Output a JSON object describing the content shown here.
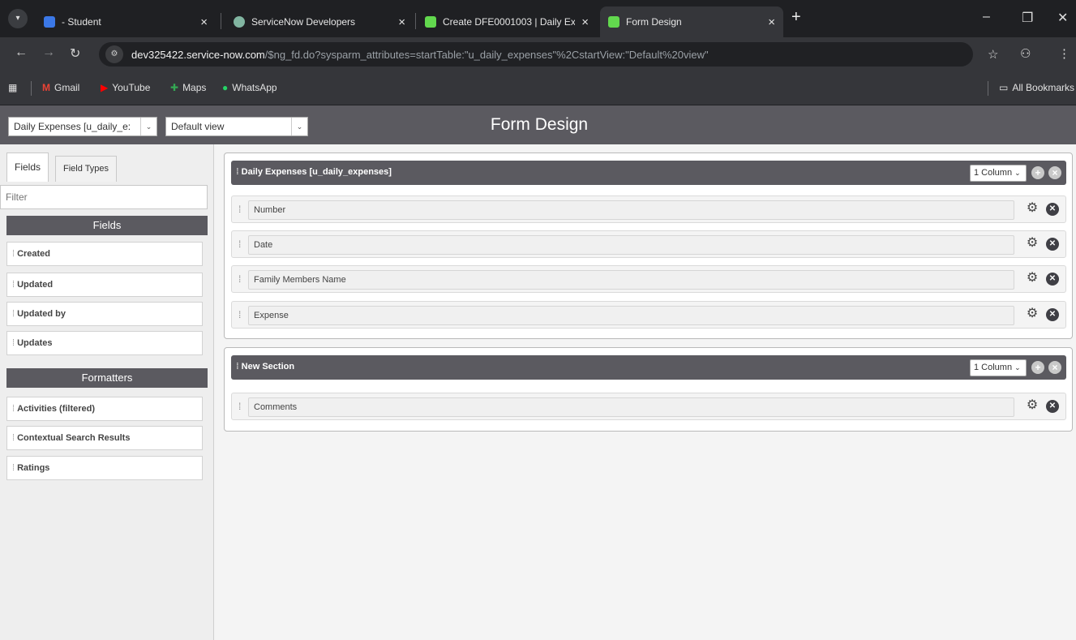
{
  "browser": {
    "tabs": [
      {
        "title": "- Student",
        "favicon_color": "#3b78e7",
        "active": false
      },
      {
        "title": "ServiceNow Developers",
        "favicon_color": "#81b5a1",
        "active": false
      },
      {
        "title": "Create DFE0001003 | Daily Exp",
        "favicon_color": "#62d84e",
        "active": false
      },
      {
        "title": "Form Design",
        "favicon_color": "#62d84e",
        "active": true
      }
    ],
    "url_host": "dev325422.service-now.com",
    "url_path": "/$ng_fd.do?sysparm_attributes=startTable:\"u_daily_expenses\"%2CstartView:\"Default%20view\"",
    "bookmarks": [
      {
        "label": "Gmail",
        "icon": "gmail-icon"
      },
      {
        "label": "YouTube",
        "icon": "youtube-icon"
      },
      {
        "label": "Maps",
        "icon": "maps-icon"
      },
      {
        "label": "WhatsApp",
        "icon": "whatsapp-icon"
      }
    ],
    "all_bookmarks": "All Bookmarks"
  },
  "header": {
    "table_select": "Daily Expenses [u_daily_e:",
    "view_select": "Default view",
    "title": "Form Design"
  },
  "left_panel": {
    "tabs": [
      "Fields",
      "Field Types"
    ],
    "filter_placeholder": "Filter",
    "fields_heading": "Fields",
    "fields": [
      "Created",
      "Updated",
      "Updated by",
      "Updates"
    ],
    "formatters_heading": "Formatters",
    "formatters": [
      "Activities (filtered)",
      "Contextual Search Results",
      "Ratings"
    ]
  },
  "sections": [
    {
      "title": "Daily Expenses [u_daily_expenses]",
      "columns": "1 Column",
      "fields": [
        "Number",
        "Date",
        "Family Members Name",
        "Expense"
      ]
    },
    {
      "title": "New Section",
      "columns": "1 Column",
      "fields": [
        "Comments"
      ]
    }
  ],
  "colors": {
    "header_bg": "#5b5a60",
    "browser_dark": "#1f2023",
    "browser_toolbar": "#35363a"
  }
}
